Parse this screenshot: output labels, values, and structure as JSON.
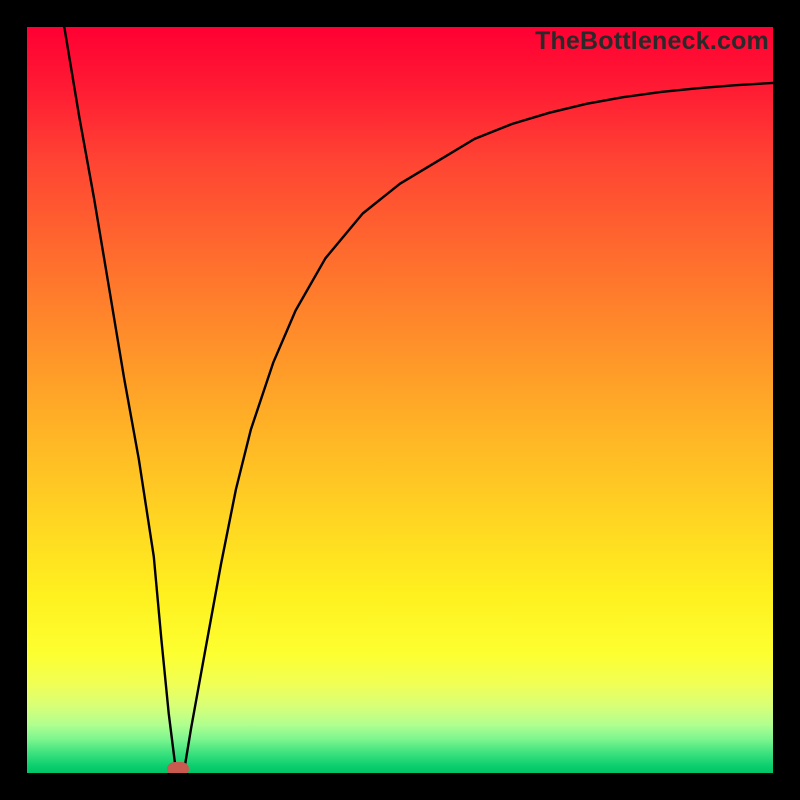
{
  "watermark": "TheBottleneck.com",
  "chart_data": {
    "type": "line",
    "title": "",
    "xlabel": "",
    "ylabel": "",
    "xlim": [
      0,
      100
    ],
    "ylim": [
      0,
      100
    ],
    "grid": false,
    "legend": false,
    "background_gradient": {
      "direction": "top-to-bottom",
      "stops": [
        {
          "pos": 0,
          "color": "#ff0033"
        },
        {
          "pos": 50,
          "color": "#ffb326"
        },
        {
          "pos": 80,
          "color": "#fdff30"
        },
        {
          "pos": 100,
          "color": "#00c466"
        }
      ]
    },
    "series": [
      {
        "name": "bottleneck-curve",
        "color": "#000000",
        "x": [
          5,
          7,
          9,
          11,
          13,
          15,
          17,
          18,
          19,
          20,
          21,
          22,
          24,
          26,
          28,
          30,
          33,
          36,
          40,
          45,
          50,
          55,
          60,
          65,
          70,
          75,
          80,
          85,
          90,
          95,
          100
        ],
        "y": [
          100,
          88,
          77,
          65,
          53,
          42,
          29,
          18,
          8,
          0,
          0,
          6,
          17,
          28,
          38,
          46,
          55,
          62,
          69,
          75,
          79,
          82,
          85,
          87,
          88.5,
          89.7,
          90.6,
          91.3,
          91.8,
          92.2,
          92.5
        ]
      }
    ],
    "marker": {
      "name": "optimal-point",
      "x": 20.3,
      "y": 0,
      "color": "#c85a4f",
      "shape": "rounded-rect"
    }
  }
}
